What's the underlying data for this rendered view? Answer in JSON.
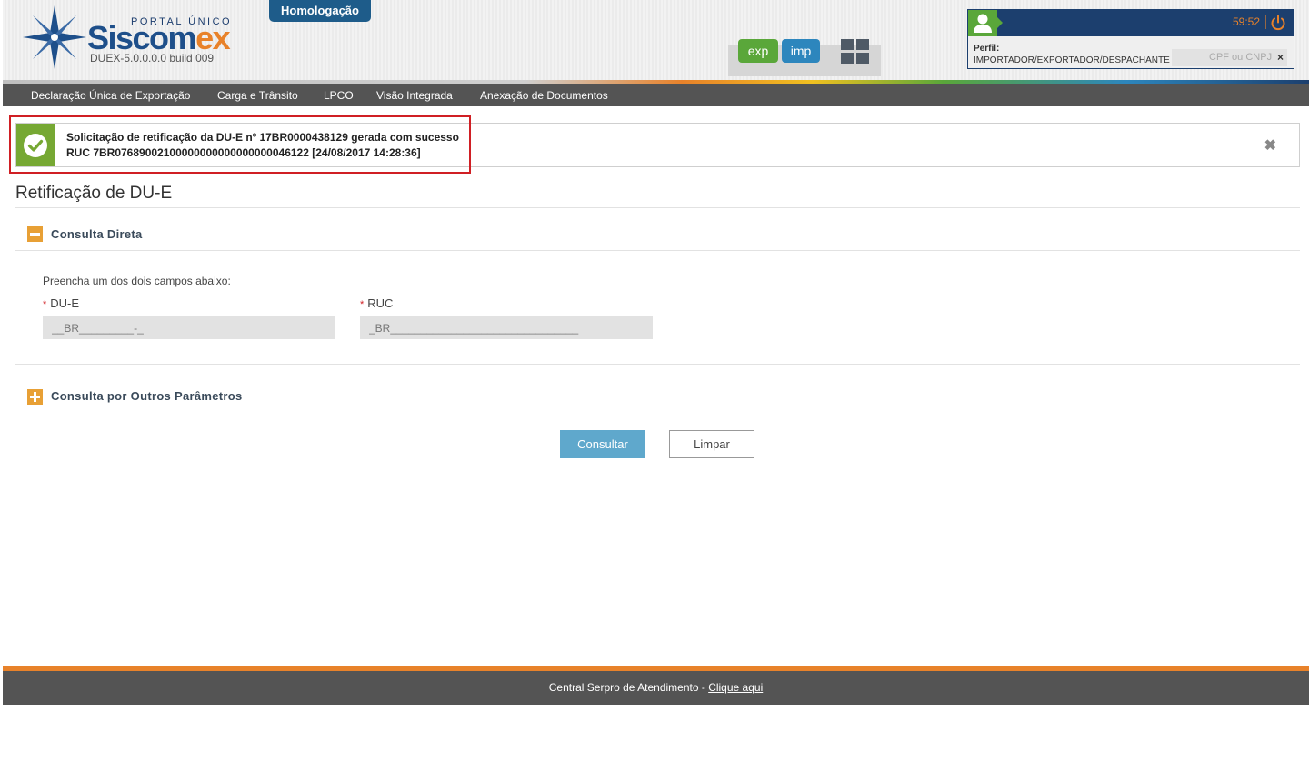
{
  "header": {
    "portal_label": "PORTAL ÚNICO",
    "brand_main": "Siscom",
    "brand_accent": "ex",
    "build": "DUEX-5.0.0.0.0  build 009",
    "environment_badge": "Homologação",
    "exp_label": "exp",
    "imp_label": "imp"
  },
  "user": {
    "timer": "59:52",
    "perfil_label": "Perfil:",
    "perfil_value": "IMPORTADOR/EXPORTADOR/DESPACHANTE",
    "cpf_placeholder": "CPF ou CNPJ",
    "clear_symbol": "×"
  },
  "nav": {
    "items": [
      {
        "label": "Declaração Única de Exportação"
      },
      {
        "label": "Carga e Trânsito"
      },
      {
        "label": "LPCO"
      },
      {
        "label": "Visão Integrada"
      },
      {
        "label": "Anexação de Documentos"
      }
    ]
  },
  "alert": {
    "line1": "Solicitação de retificação da DU-E nº 17BR0000438129 gerada com sucesso",
    "line2": "RUC 7BR07689002100000000000000000046122 [24/08/2017 14:28:36]",
    "close_symbol": "✖"
  },
  "main": {
    "page_title": "Retificação de DU-E",
    "section_direct": "Consulta Direta",
    "hint": "Preencha um dos dois campos abaixo:",
    "required_mark": "*",
    "due_label": "DU-E",
    "due_placeholder": "__BR_________-_",
    "ruc_label": "RUC",
    "ruc_placeholder": "_BR_______________________________",
    "section_other": "Consulta por Outros Parâmetros",
    "consultar_label": "Consultar",
    "limpar_label": "Limpar"
  },
  "footer": {
    "text": "Central Serpro de Atendimento - ",
    "link": "Clique aqui"
  },
  "colors": {
    "nav_bg": "#545454",
    "accent_orange": "#e8822a",
    "brand_blue": "#1e4f8a",
    "success_green": "#76a833",
    "highlight_red": "#d01f24",
    "button_blue": "#5fa8cc"
  }
}
